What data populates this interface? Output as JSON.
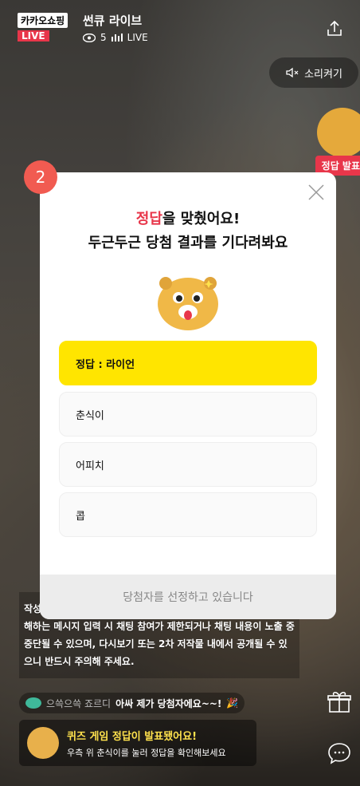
{
  "header": {
    "brand": "카카오쇼핑",
    "live_badge": "LIVE",
    "title": "썬큐 라이브",
    "viewers": "5",
    "live_label": "LIVE"
  },
  "controls": {
    "sound_label": "소리켜기",
    "answer_tag": "정답 발표"
  },
  "step": {
    "number": "2"
  },
  "modal": {
    "title_highlight": "정답",
    "title_line1_rest": "을 맞췄어요!",
    "title_line2": "두근두근 당첨 결과를 기다려봐요",
    "options": [
      {
        "label": "정답 : 라이언",
        "selected": true
      },
      {
        "label": "춘식이",
        "selected": false
      },
      {
        "label": "어피치",
        "selected": false
      },
      {
        "label": "콥",
        "selected": false
      }
    ],
    "footer": "당첨자를 선정하고 있습니다"
  },
  "chat": {
    "notice": "작성 시 주의해주세요. 욕설, 도배성 내용, 개인정보 및 사생활을 침해하는 메시지 입력 시 채팅 참여가 제한되거나 채팅 내용이 노출 중 중단될 수 있으며, 다시보기 또는 2차 저작물 내에서 공개될 수 있으니 반드시 주의해 주세요.",
    "nickname": "으쓱으쓱 죠르디",
    "message": "아싸 제가 당첨자에요~~!",
    "quiz_title": "퀴즈 게임 정답이 발표됐어요!",
    "quiz_sub": "우측 위 춘식이를 눌러 정답을 확인해보세요"
  },
  "colors": {
    "accent": "#e8364a",
    "selected": "#ffe500",
    "step": "#f15b51"
  }
}
